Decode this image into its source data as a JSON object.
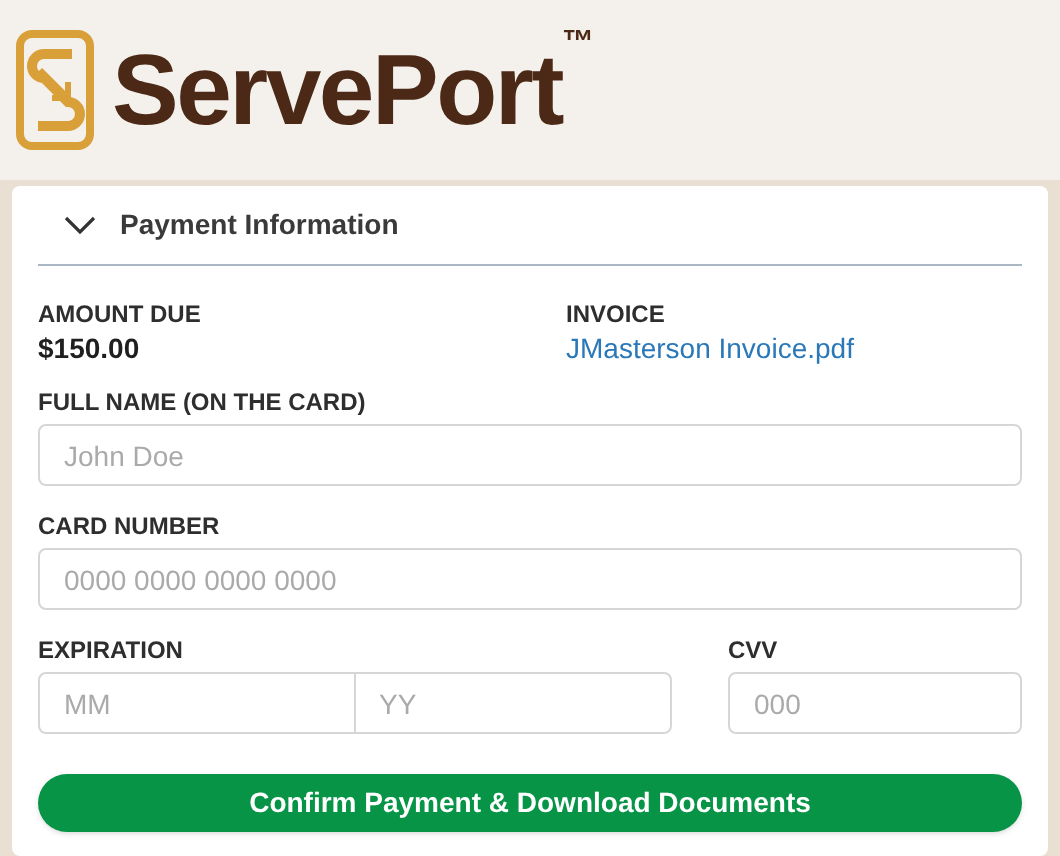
{
  "brand": {
    "name": "ServePort",
    "mark": "™"
  },
  "section": {
    "title": "Payment Information",
    "expanded": true
  },
  "summary": [
    {
      "label": "AMOUNT DUE",
      "value": "$150.00",
      "kind": "amount"
    },
    {
      "label": "INVOICE",
      "value": "JMasterson Invoice.pdf",
      "kind": "link"
    }
  ],
  "full_name": {
    "label": "FULL NAME (ON THE CARD)",
    "placeholder": "John Doe"
  },
  "card_number": {
    "label": "CARD NUMBER",
    "placeholder": "0000 0000 0000 0000"
  },
  "expiration": {
    "label": "EXPIRATION",
    "month_placeholder": "MM",
    "year_placeholder": "YY"
  },
  "cvv": {
    "label": "CVV",
    "placeholder": "000"
  },
  "button": "Confirm Payment & Download Documents"
}
